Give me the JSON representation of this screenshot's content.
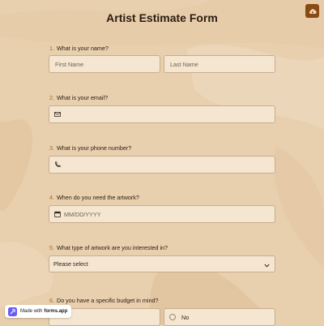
{
  "form": {
    "title": "Artist Estimate Form"
  },
  "questions": [
    {
      "num": "1.",
      "label": "What is your name?",
      "first_placeholder": "First Name",
      "last_placeholder": "Last Name"
    },
    {
      "num": "2.",
      "label": "What is your email?"
    },
    {
      "num": "3.",
      "label": "What is your phone number?"
    },
    {
      "num": "4.",
      "label": "When do you need the artwork?",
      "placeholder": "MM/DD/YYYY"
    },
    {
      "num": "5.",
      "label": "What type of artwork are you interested in?",
      "selected": "Please select"
    },
    {
      "num": "6.",
      "label": "Do you have a specific budget in mind?",
      "option_no": "No"
    }
  ],
  "badge": {
    "made_with": "Made with",
    "brand": "forms.app"
  },
  "icons": {
    "top_button": "cloud-icon",
    "email": "envelope-icon",
    "phone": "phone-icon",
    "date": "calendar-icon",
    "select": "chevron-down-icon",
    "logo": "forms-app-logo-icon"
  },
  "colors": {
    "background": "#e8cfad",
    "field": "#f5e6d1",
    "accent": "#8a4b12",
    "number": "#a86a27"
  }
}
